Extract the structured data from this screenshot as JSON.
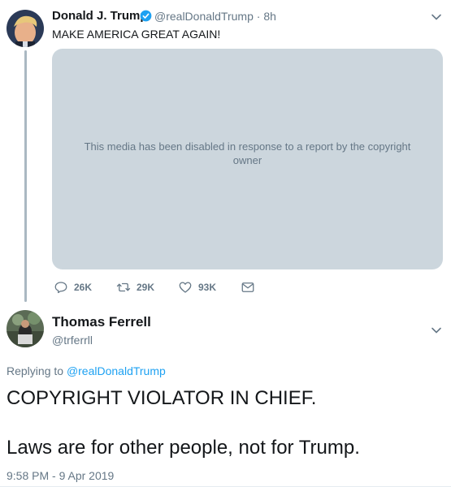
{
  "parent_tweet": {
    "display_name": "Donald J. Trump",
    "handle": "@realDonaldTrump",
    "separator": "·",
    "time_ago": "8h",
    "text": "MAKE AMERICA GREAT AGAIN!",
    "media_notice": "This media has been disabled in response to a report by the copyright owner",
    "actions": {
      "reply_count": "26K",
      "retweet_count": "29K",
      "like_count": "93K"
    }
  },
  "reply_tweet": {
    "display_name": "Thomas Ferrell",
    "handle": "@trferrll",
    "replying_prefix": "Replying to",
    "replying_to": "@realDonaldTrump",
    "line1": "COPYRIGHT VIOLATOR IN CHIEF.",
    "line2": "Laws are for other people, not for Trump.",
    "timestamp": "9:58 PM - 9 Apr 2019"
  },
  "icons": {
    "verified": "verified-badge-icon",
    "chevron": "chevron-down-icon",
    "reply": "reply-icon",
    "retweet": "retweet-icon",
    "like": "heart-icon",
    "dm": "envelope-icon"
  },
  "colors": {
    "accent": "#1da1f2",
    "muted": "#657786",
    "media_bg": "#ccd6dd",
    "thread_line": "#aab8c2"
  }
}
